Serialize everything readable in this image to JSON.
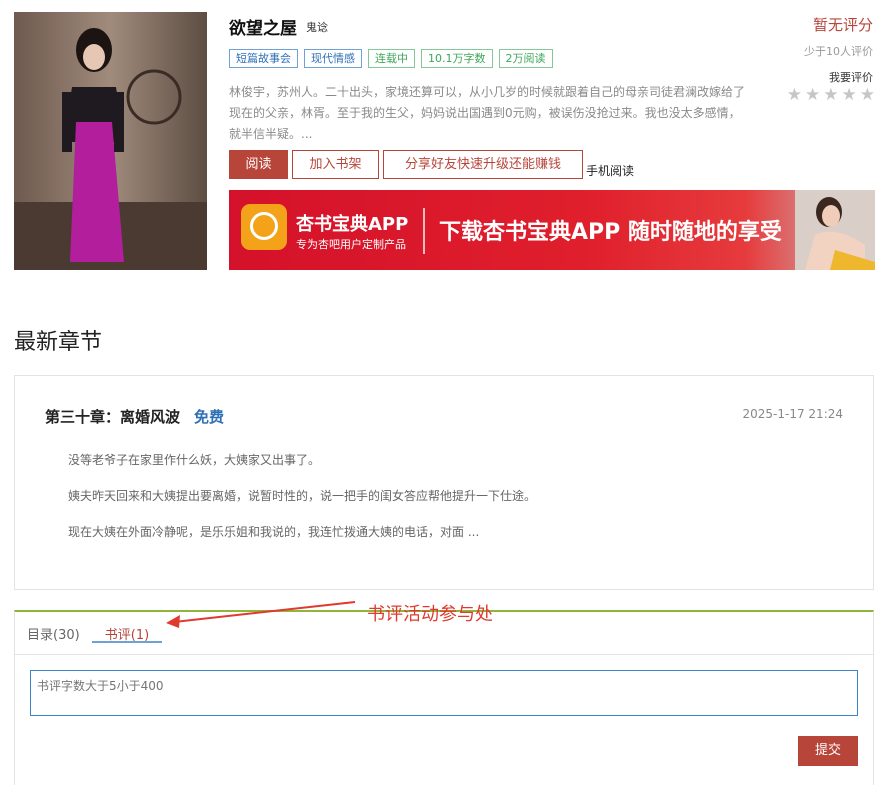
{
  "book": {
    "title": "欲望之屋",
    "author": "鬼谂",
    "tags": [
      {
        "label": "短篇故事会",
        "style": "blue"
      },
      {
        "label": "现代情感",
        "style": "blue"
      },
      {
        "label": "连载中",
        "style": "green"
      },
      {
        "label": "10.1万字数",
        "style": "green"
      },
      {
        "label": "2万阅读",
        "style": "green"
      }
    ],
    "intro_line1": "林俊宇，苏州人。二十出头，家境还算可以，从小几岁的时候就跟着自己的母亲司徒君澜改嫁给了",
    "intro_line2": "现在的父亲，林胥。至于我的生父，妈妈说出国遇到0元购，被误伤没抢过来。我也没太多感情，",
    "intro_line3": "就半信半疑。..."
  },
  "actions": {
    "read": "阅读",
    "add_shelf": "加入书架",
    "share": "分享好友快速升级还能赚钱",
    "mobile": "手机阅读"
  },
  "banner": {
    "app_name": "杏书宝典APP",
    "app_sub": "专为杏吧用户定制产品",
    "slogan": "下载杏书宝典APP 随时随地的享受"
  },
  "rating": {
    "score_text": "暂无评分",
    "sub_text": "少于10人评价",
    "review_link": "我要评价",
    "stars_filled": 0,
    "stars_total": 5
  },
  "latest": {
    "section_title": "最新章节",
    "chapter_title": "第三十章：离婚风波",
    "free_label": "免费",
    "date": "2025-1-17 21:24",
    "paragraphs": [
      "没等老爷子在家里作什么妖，大姨家又出事了。",
      "姨夫昨天回来和大姨提出要离婚，说暂时性的，说一把手的闺女答应帮他提升一下仕途。",
      "现在大姨在外面冷静呢，是乐乐姐和我说的，我连忙拨通大姨的电话，对面 ..."
    ]
  },
  "tabs": {
    "toc": "目录(30)",
    "review": "书评(1)"
  },
  "annotation": "书评活动参与处",
  "review_form": {
    "placeholder": "书评字数大于5小于400",
    "submit": "提交"
  },
  "colors": {
    "accent": "#b8453a",
    "tag_blue": "#2f6fb6",
    "tag_green": "#3da65a",
    "annotation_red": "#e03a2f"
  }
}
